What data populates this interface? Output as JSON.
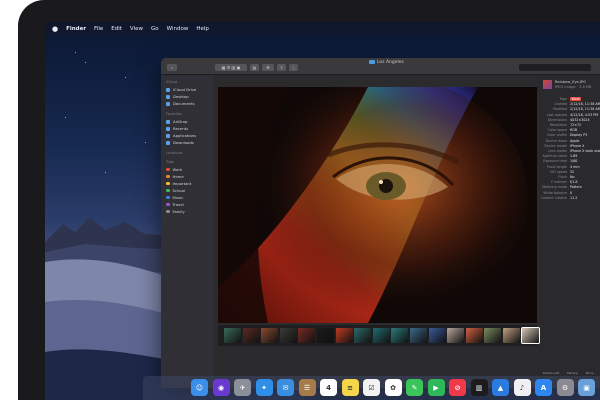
{
  "menubar": {
    "items": [
      "Finder",
      "File",
      "Edit",
      "View",
      "Go",
      "Window",
      "Help"
    ]
  },
  "window": {
    "title": "Los Angeles",
    "search_placeholder": ""
  },
  "sidebar": {
    "sections": [
      {
        "heading": "iCloud",
        "items": [
          "iCloud Drive",
          "Desktop",
          "Documents"
        ]
      },
      {
        "heading": "Favorites",
        "items": [
          "AirDrop",
          "Recents",
          "Applications",
          "Downloads"
        ]
      },
      {
        "heading": "Locations",
        "items": []
      },
      {
        "heading": "Tags",
        "items": [
          "Work",
          "Home",
          "Important",
          "School",
          "Music",
          "Travel",
          "Family"
        ]
      }
    ],
    "tag_colors": [
      "#e34b3d",
      "#f08a2c",
      "#f2c531",
      "#3fbf53",
      "#3b82e6",
      "#9b59d0",
      "#8e8e93"
    ]
  },
  "inspector": {
    "file_name": "Rainbow_Eye.JPG",
    "file_info": "JPEG image · 3.8 MB",
    "rows": [
      {
        "k": "Tags",
        "v": "Work",
        "tag": true
      },
      {
        "k": "Created",
        "v": "2/12/18, 11:38 AM"
      },
      {
        "k": "Modified",
        "v": "2/12/18, 11:38 AM"
      },
      {
        "k": "Last opened",
        "v": "4/12/18, 4:53 PM"
      },
      {
        "k": "Dimensions",
        "v": "4032×3024"
      },
      {
        "k": "Resolution",
        "v": "72×72"
      },
      {
        "k": "Color space",
        "v": "RGB"
      },
      {
        "k": "Color profile",
        "v": "Display P3"
      },
      {
        "k": "Device make",
        "v": "Apple"
      },
      {
        "k": "Device model",
        "v": "iPhone X"
      },
      {
        "k": "Lens model",
        "v": "iPhone X back dual camera 4mm f/1.8"
      },
      {
        "k": "Aperture value",
        "v": "1.69"
      },
      {
        "k": "Exposure time",
        "v": "1/60"
      },
      {
        "k": "Focal length",
        "v": "4 mm"
      },
      {
        "k": "ISO speed",
        "v": "32"
      },
      {
        "k": "Flash",
        "v": "No"
      },
      {
        "k": "F number",
        "v": "f/1.8"
      },
      {
        "k": "Metering mode",
        "v": "Pattern"
      },
      {
        "k": "White balance",
        "v": "0"
      },
      {
        "k": "Content Creator",
        "v": "11.2"
      }
    ],
    "footer": [
      "Rotate Left",
      "Markup",
      "More..."
    ]
  },
  "filmstrip": {
    "thumbs": [
      "#3a6a5a",
      "#5a2a20",
      "#8a4a30",
      "#3a3a38",
      "#7a2a24",
      "#1a1a1a",
      "#c03a20",
      "#2a6a6a",
      "#206a70",
      "#2a7a7a",
      "#3a6a8a",
      "#3a5a9a",
      "#b8a8a0",
      "#d06040",
      "#7a8a60",
      "#c0a080",
      "#d8c8b8"
    ],
    "selected_index": 16
  },
  "dock": {
    "icons": [
      {
        "name": "finder-icon",
        "color": "#3b8fe8",
        "glyph": "☺"
      },
      {
        "name": "siri-icon",
        "color": "#6a3ad0",
        "glyph": "◉"
      },
      {
        "name": "launchpad-icon",
        "color": "#8a8f9a",
        "glyph": "✈"
      },
      {
        "name": "safari-icon",
        "color": "#2e8ee8",
        "glyph": "✦"
      },
      {
        "name": "mail-icon",
        "color": "#3a8ee0",
        "glyph": "✉"
      },
      {
        "name": "contacts-icon",
        "color": "#a57b4a",
        "glyph": "☰"
      },
      {
        "name": "calendar-icon",
        "color": "#ffffff",
        "glyph": "4"
      },
      {
        "name": "notes-icon",
        "color": "#f5d54a",
        "glyph": "≡"
      },
      {
        "name": "reminders-icon",
        "color": "#f2f2f2",
        "glyph": "☑"
      },
      {
        "name": "photos-icon",
        "color": "#ffffff",
        "glyph": "✿"
      },
      {
        "name": "messages-icon",
        "color": "#3ac45a",
        "glyph": "✎"
      },
      {
        "name": "facetime-icon",
        "color": "#2fb85a",
        "glyph": "▶"
      },
      {
        "name": "news-icon",
        "color": "#f03a4a",
        "glyph": "⊘"
      },
      {
        "name": "stocks-icon",
        "color": "#1c1c1e",
        "glyph": "▥"
      },
      {
        "name": "keynote-icon",
        "color": "#2a7ae0",
        "glyph": "▲"
      },
      {
        "name": "music-icon",
        "color": "#f0f0f2",
        "glyph": "♪"
      },
      {
        "name": "app-store-icon",
        "color": "#2f86f0",
        "glyph": "A"
      },
      {
        "name": "system-preferences-icon",
        "color": "#8a8a90",
        "glyph": "⚙"
      },
      {
        "name": "preview-icon",
        "color": "#6aa0d8",
        "glyph": "▣"
      }
    ]
  }
}
